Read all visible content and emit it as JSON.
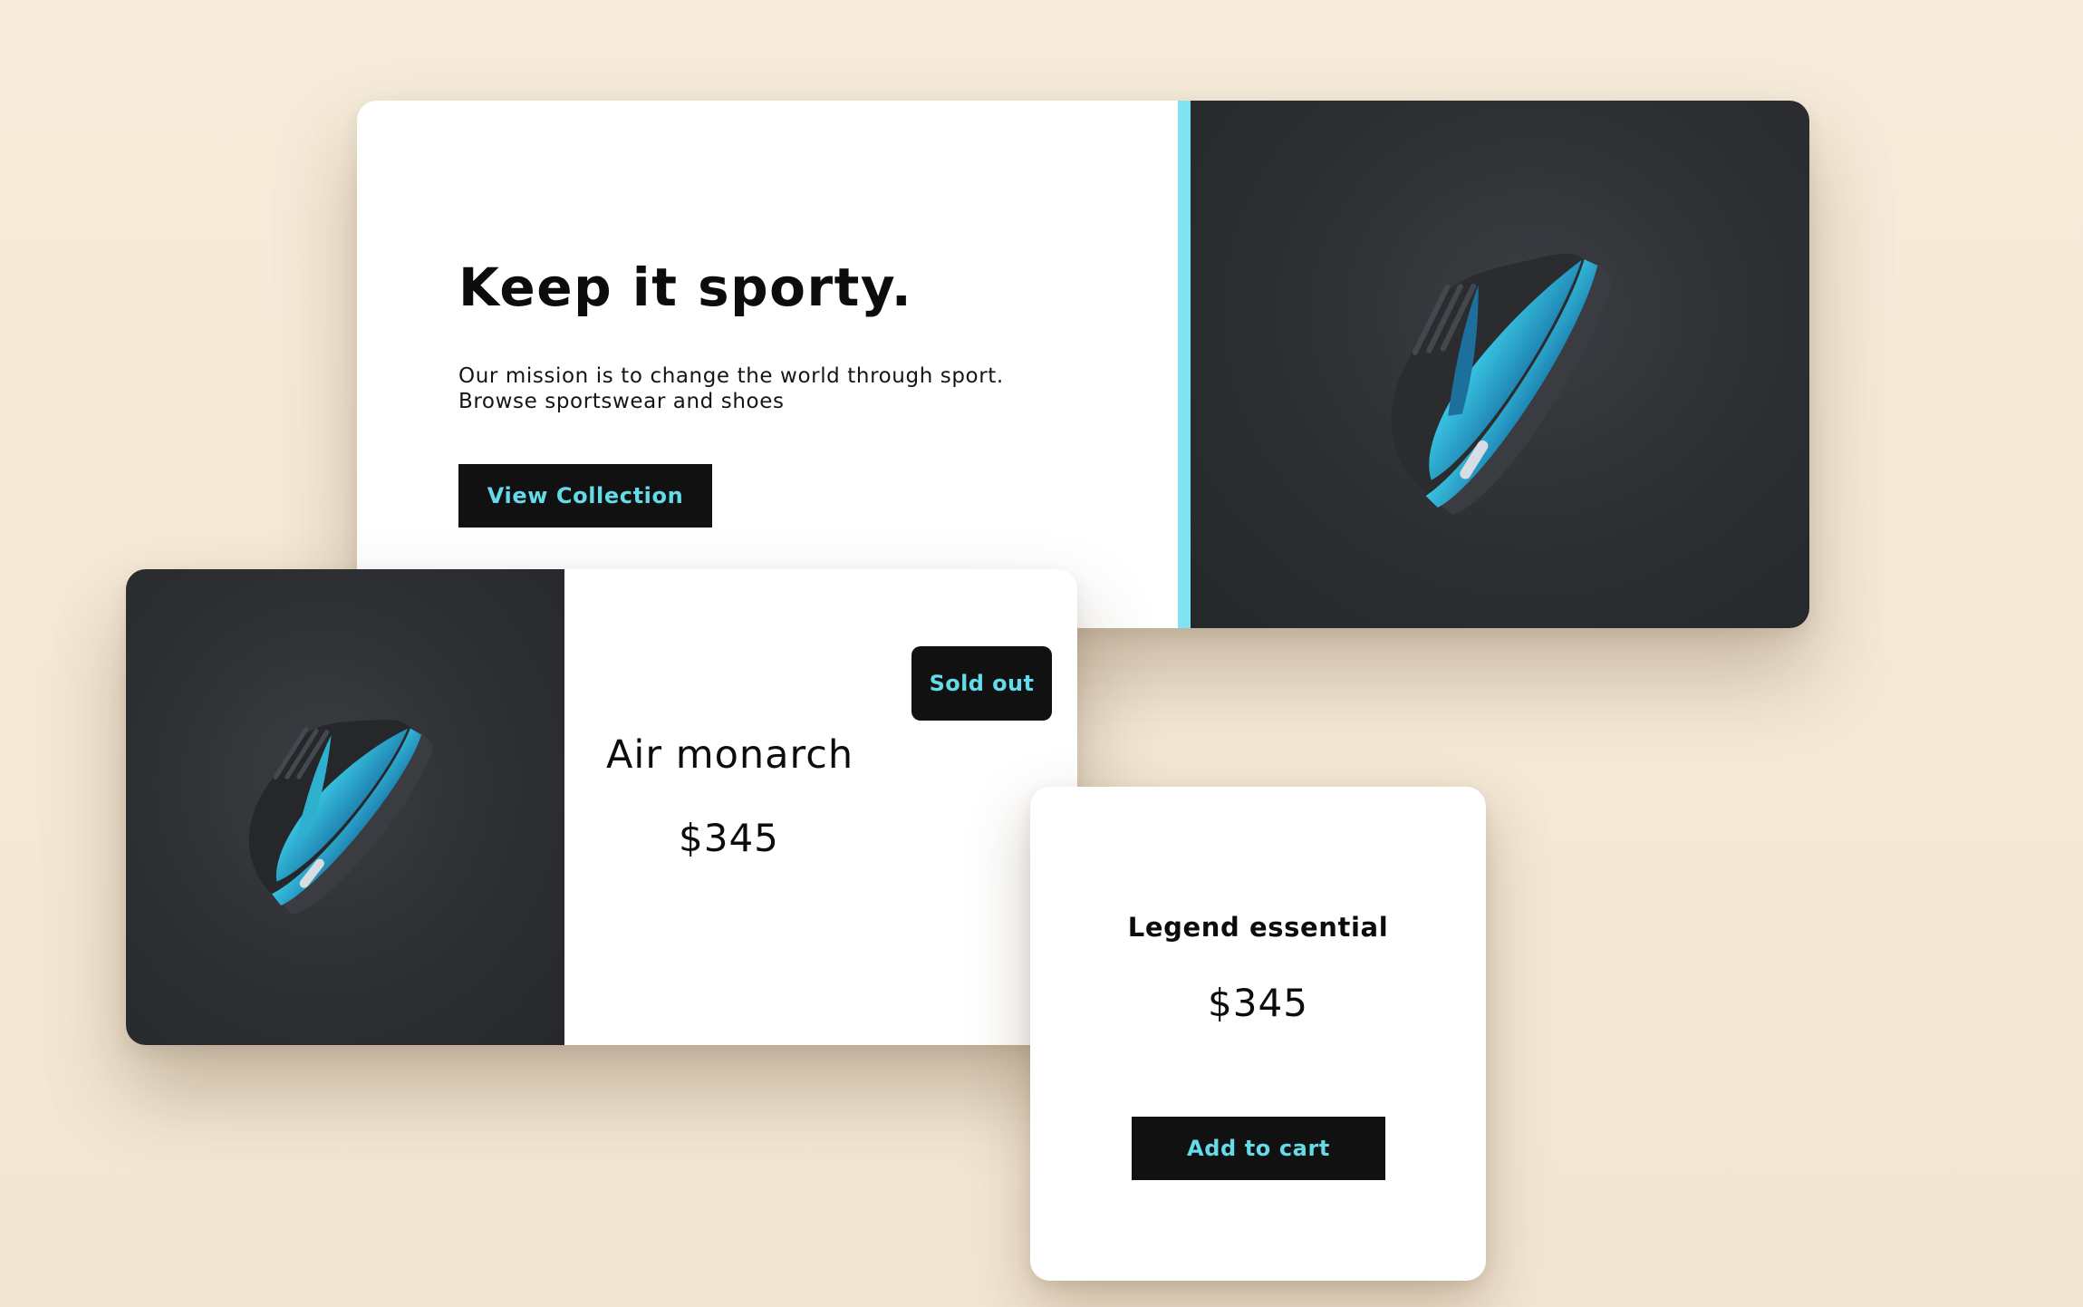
{
  "hero": {
    "title": "Keep it sporty.",
    "description": "Our mission is to change the world through sport. Browse sportswear and shoes",
    "button_label": "View Collection",
    "image_icon": "sneaker-image"
  },
  "product": {
    "badge": "Sold out",
    "name": "Air monarch",
    "price": "$345",
    "image_icon": "sneaker-image"
  },
  "legend": {
    "name": "Legend essential",
    "price": "$345",
    "button_label": "Add to cart"
  },
  "colors": {
    "background": "#f6ebda",
    "accent_cyan": "#63dbe9",
    "stripe": "#7fe3f4",
    "button_dark": "#111112",
    "media_dark": "#2c2e32",
    "shoe_blue": "#2fa6c8"
  }
}
